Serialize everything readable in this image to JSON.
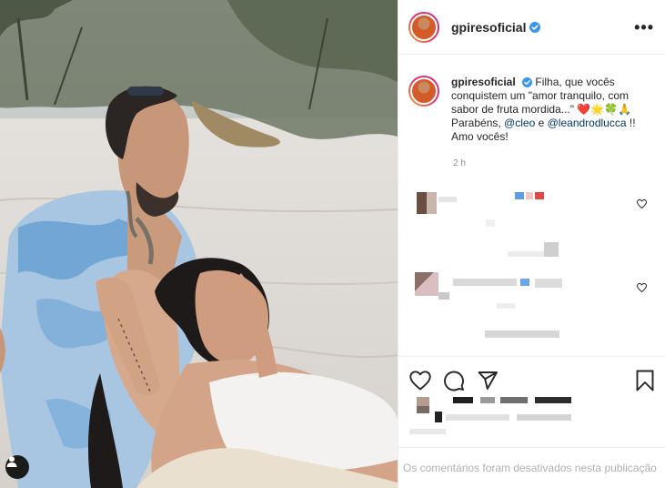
{
  "post": {
    "username": "gpiresoficial",
    "verified": true,
    "caption": {
      "text_1": "Filha, que vocês conquistem um \"amor tranquilo, com sabor de fruta mordida...\"",
      "emojis": "❤️🌟🍀🙏",
      "text_2": "Parabéns,",
      "mention_1": "@cleo",
      "text_3": "e",
      "mention_2": "@leandrodlucca",
      "text_4": "!! Amo vocês!"
    },
    "time_ago": "2 h",
    "comments_disabled_text": "Os comentários foram desativados nesta publicação"
  },
  "icons": {
    "more": "more-options-icon",
    "like": "heart-icon",
    "comment": "comment-icon",
    "share": "share-icon",
    "save": "bookmark-icon",
    "user_tag": "user-tag-icon"
  },
  "colors": {
    "link": "#00376b",
    "verified": "#3897f0",
    "muted": "#8e8e8e"
  }
}
